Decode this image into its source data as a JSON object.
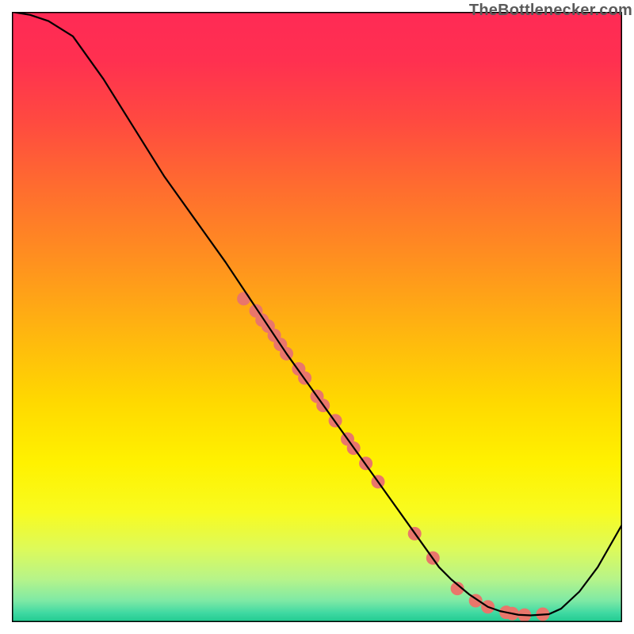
{
  "watermark_text": "TheBottlenecker.com",
  "chart_data": {
    "type": "line",
    "title": "",
    "xlabel": "",
    "ylabel": "",
    "xlim": [
      0,
      100
    ],
    "ylim": [
      0,
      100
    ],
    "curve": {
      "x": [
        0,
        3,
        6,
        10,
        15,
        20,
        25,
        30,
        35,
        40,
        45,
        50,
        55,
        60,
        65,
        70,
        72,
        75,
        78,
        80,
        83,
        85,
        88,
        90,
        93,
        96,
        100
      ],
      "y": [
        100,
        99.5,
        98.5,
        96,
        89,
        81,
        73,
        66,
        59,
        51.5,
        44,
        37,
        30,
        23,
        16,
        9,
        7,
        4.5,
        2.5,
        1.8,
        1.2,
        1.1,
        1.3,
        2.2,
        5,
        9,
        16
      ]
    },
    "markers": {
      "x": [
        38,
        40,
        41,
        42,
        43,
        44,
        45,
        47,
        48,
        50,
        51,
        53,
        55,
        56,
        58,
        60,
        66,
        69,
        73,
        76,
        78,
        81,
        82,
        84,
        87
      ],
      "y": [
        53,
        51,
        49.5,
        48.5,
        47,
        45.5,
        44,
        41.5,
        40,
        37,
        35.5,
        33,
        30,
        28.5,
        26,
        23,
        14.5,
        10.5,
        5.5,
        3.5,
        2.5,
        1.6,
        1.4,
        1.15,
        1.3
      ]
    },
    "gradient_stops": [
      {
        "offset": 0.0,
        "color": "#ff2a55"
      },
      {
        "offset": 0.08,
        "color": "#ff3050"
      },
      {
        "offset": 0.18,
        "color": "#ff4a40"
      },
      {
        "offset": 0.28,
        "color": "#ff6a30"
      },
      {
        "offset": 0.4,
        "color": "#ff8e20"
      },
      {
        "offset": 0.52,
        "color": "#ffb410"
      },
      {
        "offset": 0.64,
        "color": "#ffd900"
      },
      {
        "offset": 0.74,
        "color": "#fff200"
      },
      {
        "offset": 0.82,
        "color": "#f8fb20"
      },
      {
        "offset": 0.88,
        "color": "#ddfa5a"
      },
      {
        "offset": 0.93,
        "color": "#b6f48a"
      },
      {
        "offset": 0.965,
        "color": "#7ee9a5"
      },
      {
        "offset": 0.985,
        "color": "#3fd9a2"
      },
      {
        "offset": 1.0,
        "color": "#1fca8f"
      }
    ],
    "marker_fill": "#e9766b",
    "marker_stroke": "#e9766b",
    "marker_radius_avg": 8,
    "curve_stroke": "#000000",
    "curve_stroke_width": 2.2,
    "border_stroke": "#000000",
    "border_stroke_width": 3
  }
}
